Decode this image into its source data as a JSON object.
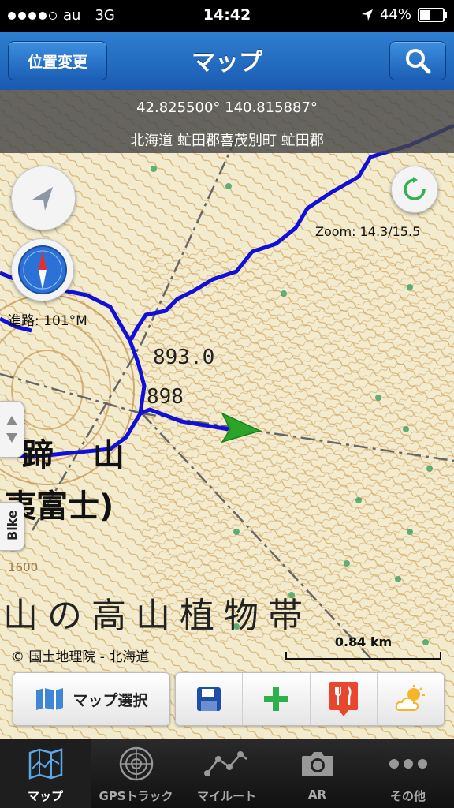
{
  "status": {
    "carrier": "au",
    "network": "3G",
    "time": "14:42",
    "battery": "44%",
    "signal_bars": 4,
    "battery_level": 0.44
  },
  "nav": {
    "left_button": "位置変更",
    "title": "マップ",
    "search_icon": "search-icon"
  },
  "info": {
    "coords": "42.825500° 140.815887°",
    "address": "北海道 虻田郡喜茂別町 虻田郡"
  },
  "map": {
    "zoom": "Zoom: 14.3/15.5",
    "heading": "進路: 101°M",
    "bike_label": "Bike",
    "copyright": "© 国土地理院 - 北海道",
    "scale": "0.84 km",
    "labels": {
      "elev1": "893.0",
      "elev2": "898",
      "peak": "蹄 山",
      "name": "夷富士)",
      "zone": "山の高山植物帯",
      "contour": "1600"
    },
    "colors": {
      "track": "#1010d8",
      "arrow": "#2aa52a",
      "contour": "#c9a05a"
    }
  },
  "toolbar": {
    "map_select": "マップ選択",
    "icons": [
      "save-icon",
      "add-icon",
      "restaurant-pin-icon",
      "weather-icon"
    ]
  },
  "tabs": [
    {
      "label": "マップ",
      "icon": "map-icon",
      "active": true
    },
    {
      "label": "GPSトラック",
      "icon": "radar-icon",
      "active": false
    },
    {
      "label": "マイルート",
      "icon": "route-icon",
      "active": false
    },
    {
      "label": "AR",
      "icon": "camera-icon",
      "active": false
    },
    {
      "label": "その他",
      "icon": "more-icon",
      "active": false
    }
  ]
}
